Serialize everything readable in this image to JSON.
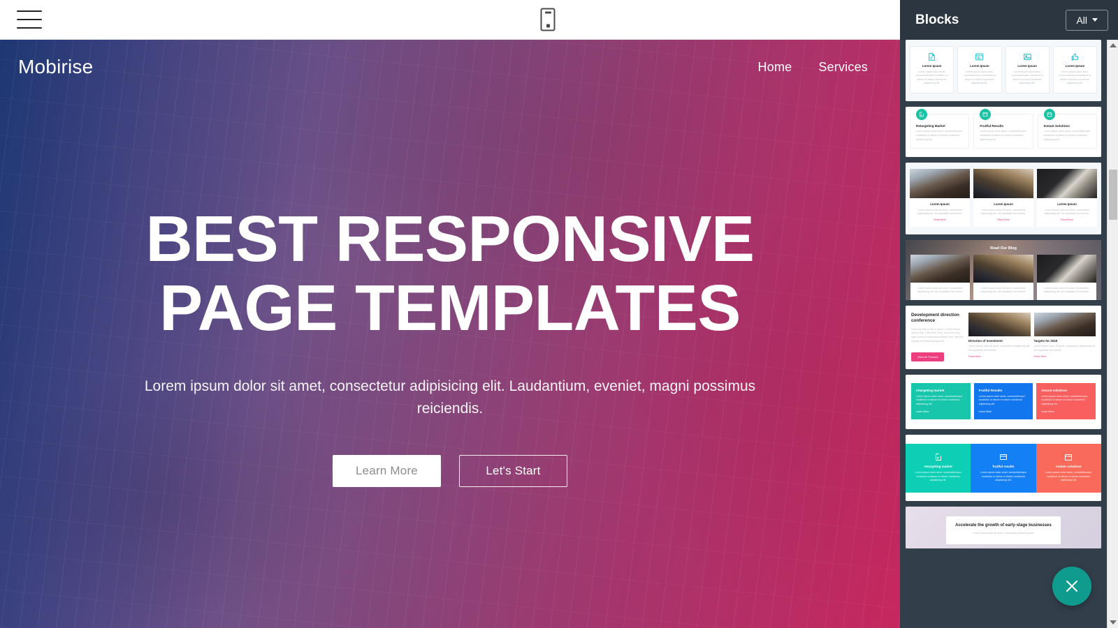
{
  "toolbar": {
    "menu_icon": "hamburger-icon",
    "device_icon": "mobile-phone-icon"
  },
  "hero": {
    "brand": "Mobirise",
    "nav": [
      {
        "label": "Home"
      },
      {
        "label": "Services"
      }
    ],
    "title": "BEST RESPONSIVE PAGE TEMPLATES",
    "subtitle": "Lorem ipsum dolor sit amet, consectetur adipisicing elit. Laudantium, eveniet, magni possimus reiciendis.",
    "buttons": [
      {
        "label": "Learn More",
        "style": "light"
      },
      {
        "label": "Let's Start",
        "style": "outline"
      }
    ],
    "gradient_from": "#1a3878",
    "gradient_to": "#cc265c"
  },
  "panel": {
    "title": "Blocks",
    "filter": {
      "label": "All",
      "caret_icon": "chevron-down-icon"
    },
    "close_button": {
      "icon": "close-icon",
      "color": "#0f9b8e"
    },
    "scrollbar": {
      "up_icon": "triangle-up-icon",
      "down_icon": "triangle-down-icon"
    },
    "blocks": [
      {
        "id": "features-4col-icons",
        "type": "cards4",
        "cards": [
          {
            "icon": "note-edit-icon",
            "title": "Lorem Ipsum",
            "text": "Lorem ipsum dolor amet, consectetempor incididunt ut labore et dolore numbertur adipisicing elit."
          },
          {
            "icon": "browser-icon",
            "title": "Lorem Ipsum",
            "text": "Lorem ipsum dolor amet, consectetempor incididunt ut labore et dolore numbertur adipisicing elit."
          },
          {
            "icon": "image-icon",
            "title": "Lorem Ipsum",
            "text": "Lorem ipsum dolor amet, consectetempor incididunt ut labore et dolore numbertur adipisicing elit."
          },
          {
            "icon": "thumbs-up-icon",
            "title": "Lorem Ipsum",
            "text": "Lorem ipsum dolor amet, consectetempor incididunt ut labore et dolore numbertur adipisicing elit."
          }
        ]
      },
      {
        "id": "features-3col-badge",
        "type": "cards3badge",
        "badge_color": "#19c3a3",
        "cards": [
          {
            "icon": "note-edit-icon",
            "title": "Retargeting Market",
            "text": "Lorem ipsum dolor amet, consectetempor incididunt ut labore et dolore numbertur adipisicing elit."
          },
          {
            "icon": "browser-icon",
            "title": "Fruitful Results",
            "text": "Lorem ipsum dolor amet, consectetempor incididunt ut labore et dolore numbertur adipisicing elit."
          },
          {
            "icon": "calendar-icon",
            "title": "Instant Solutions",
            "text": "Lorem ipsum dolor amet, consectetempor incididunt ut labore et dolore numbertur adipisicing elit."
          }
        ]
      },
      {
        "id": "blog-3col-cards",
        "type": "imgcards3",
        "cards": [
          {
            "title": "Lorem Ipsum",
            "text": "Lorem ipsum dolor sit amet, consectetur adipisicing elit. No cupiditate est eveniet.",
            "link": "Read More"
          },
          {
            "title": "Lorem Ipsum",
            "text": "Lorem ipsum dolor sit amet, consectetur adipisicing elit. No cupiditate est eveniet.",
            "link": "Read More"
          },
          {
            "title": "Lorem Ipsum",
            "text": "Lorem ipsum dolor sit amet, consectetur adipisicing elit. No cupiditate est eveniet.",
            "link": "Read More"
          }
        ]
      },
      {
        "id": "blog-header-3col",
        "type": "blogheader",
        "heading": "Read Our Blog",
        "cards": [
          {
            "text": "Lorem ipsum dolor sit amet, consectetur adipisicing elit. No cupiditate est eveniet."
          },
          {
            "text": "Lorem ipsum dolor sit amet, consectetur adipisicing elit. No cupiditate est eveniet."
          },
          {
            "text": "Lorem ipsum dolor sit amet, consectetur adipisicing elit. No cupiditate est eveniet."
          }
        ]
      },
      {
        "id": "article-split",
        "type": "articlesplit",
        "heading": "Development direction conference",
        "text": "Click any text to edit or style it. Select text to insert a link. Click blue 'Gear' icon in the top right corner to hide/show buttons, text, title and change the block background.",
        "button": "View All Themes",
        "cards": [
          {
            "title": "Direction of Investment",
            "text": "Lorem ipsum dolor sit amet, consectetur adipisicing elit. No cupiditate est eveniet.",
            "link": "Read More"
          },
          {
            "title": "Targets for 2018",
            "text": "Lorem ipsum dolor sit amet, consectetur adipisicing elit. No cupiditate est eveniet.",
            "link": "Read More"
          }
        ]
      },
      {
        "id": "colored-cards-3col",
        "type": "colorcards",
        "cards": [
          {
            "title": "retargeting market",
            "text": "Lorem ipsum dolor amet, consectetempor incididunt ut labore et dolore numbertur adipisicing elit.",
            "link": "Learn More",
            "color": "#18c6ac"
          },
          {
            "title": "Fruitful Results",
            "text": "Lorem ipsum dolor amet, consectetempor incididunt ut labore et dolore numbertur adipisicing elit.",
            "link": "Learn More",
            "color": "#1277ef"
          },
          {
            "title": "instant solutions",
            "text": "Lorem ipsum dolor amet, consectetempor incididunt ut labore et dolore numbertur adipisicing elit.",
            "link": "Learn More",
            "color": "#f85f5f"
          }
        ]
      },
      {
        "id": "colored-panels-3col",
        "type": "colorpanels",
        "cards": [
          {
            "icon": "note-edit-icon",
            "title": "retargeting market",
            "text": "Lorem ipsum dolor amet, consectetempor incididunt ut labore et dolore numbertur adipisicing elit.",
            "color": "#0ccfb6"
          },
          {
            "icon": "browser-icon",
            "title": "fruitful results",
            "text": "Lorem ipsum dolor amet, consectetempor incididunt ut labore et dolore numbertur adipisicing elit.",
            "color": "#1480f5"
          },
          {
            "icon": "calendar-icon",
            "title": "instant solutions",
            "text": "Lorem ipsum dolor amet, consectetempor incididunt ut labore et dolore numbertur adipisicing elit.",
            "color": "#f96a5b"
          }
        ]
      },
      {
        "id": "cta-growth",
        "type": "ctapanel",
        "heading": "Accelerate the growth of early-stage businesses",
        "text": "Lorem ipsum dolor sit amet, consectetur adipisicing elit."
      }
    ]
  }
}
